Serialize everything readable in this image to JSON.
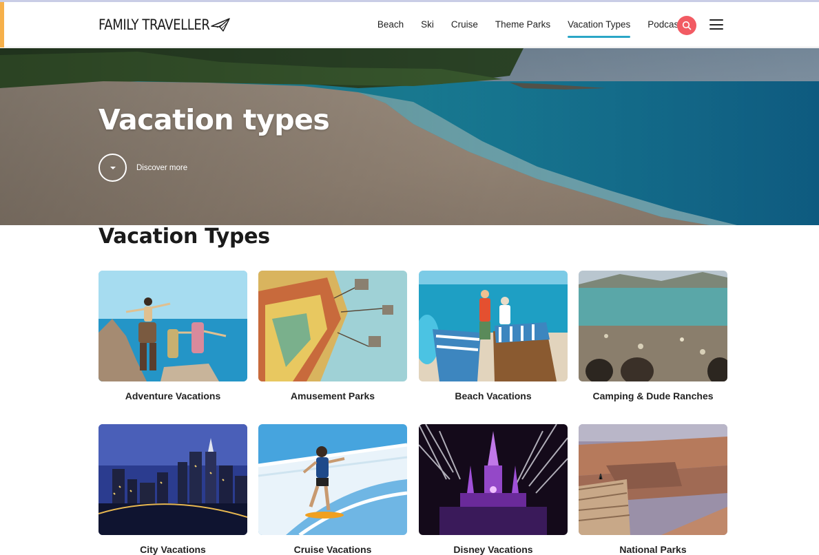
{
  "colors": {
    "accent_teal": "#2aa6c6",
    "search_red": "#f25b63",
    "side_accent": "#f6b04a"
  },
  "header": {
    "logo": "FAMILY TRAVELLER",
    "nav": [
      {
        "label": "Beach"
      },
      {
        "label": "Ski"
      },
      {
        "label": "Cruise"
      },
      {
        "label": "Theme Parks"
      },
      {
        "label": "Vacation Types",
        "active": true
      },
      {
        "label": "Podcast"
      }
    ],
    "search_icon": "search-icon",
    "menu_icon": "hamburger-menu-icon"
  },
  "hero": {
    "title": "Vacation types",
    "discover_label": "Discover more",
    "discover_icon": "caret-down-icon"
  },
  "section": {
    "title": "Vacation Types",
    "cards": [
      {
        "label": "Adventure Vacations"
      },
      {
        "label": "Amusement Parks"
      },
      {
        "label": "Beach Vacations"
      },
      {
        "label": "Camping & Dude Ranches"
      },
      {
        "label": "City Vacations"
      },
      {
        "label": "Cruise Vacations"
      },
      {
        "label": "Disney Vacations"
      },
      {
        "label": "National Parks"
      }
    ]
  }
}
